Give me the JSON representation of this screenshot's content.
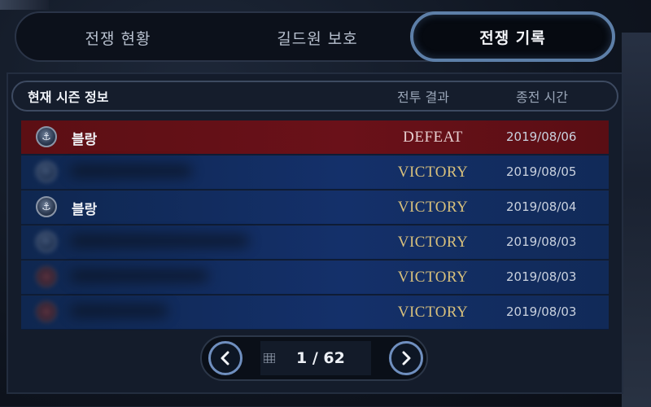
{
  "tabs": [
    {
      "label": "전쟁 현황",
      "active": false
    },
    {
      "label": "길드원 보호",
      "active": false
    },
    {
      "label": "전쟁 기록",
      "active": true
    }
  ],
  "table": {
    "header": {
      "title": "현재 시즌 정보",
      "result": "전투 결과",
      "time": "종전 시간"
    },
    "rows": [
      {
        "guild": "블랑",
        "result": "DEFEAT",
        "date": "2019/08/06",
        "emblem": "anchor-emblem-icon",
        "blurred": false
      },
      {
        "guild": "",
        "result": "VICTORY",
        "date": "2019/08/05",
        "emblem": "guild-emblem-icon",
        "blurred": true
      },
      {
        "guild": "블랑",
        "result": "VICTORY",
        "date": "2019/08/04",
        "emblem": "anchor-emblem-icon",
        "blurred": false
      },
      {
        "guild": "",
        "result": "VICTORY",
        "date": "2019/08/03",
        "emblem": "guild-emblem-icon",
        "blurred": true
      },
      {
        "guild": "",
        "result": "VICTORY",
        "date": "2019/08/03",
        "emblem": "guild-emblem-icon",
        "blurred": true
      },
      {
        "guild": "",
        "result": "VICTORY",
        "date": "2019/08/03",
        "emblem": "guild-emblem-icon",
        "blurred": true
      }
    ]
  },
  "pager": {
    "current": "1 / 62",
    "prev_icon": "chevron-left-icon",
    "next_icon": "chevron-right-icon",
    "grid_icon": "grid-icon"
  },
  "colors": {
    "defeat_row": "#6a1119",
    "victory_row": "#14306a",
    "victory_text": "#d8c07c",
    "active_tab_border": "#5d7fa8"
  }
}
